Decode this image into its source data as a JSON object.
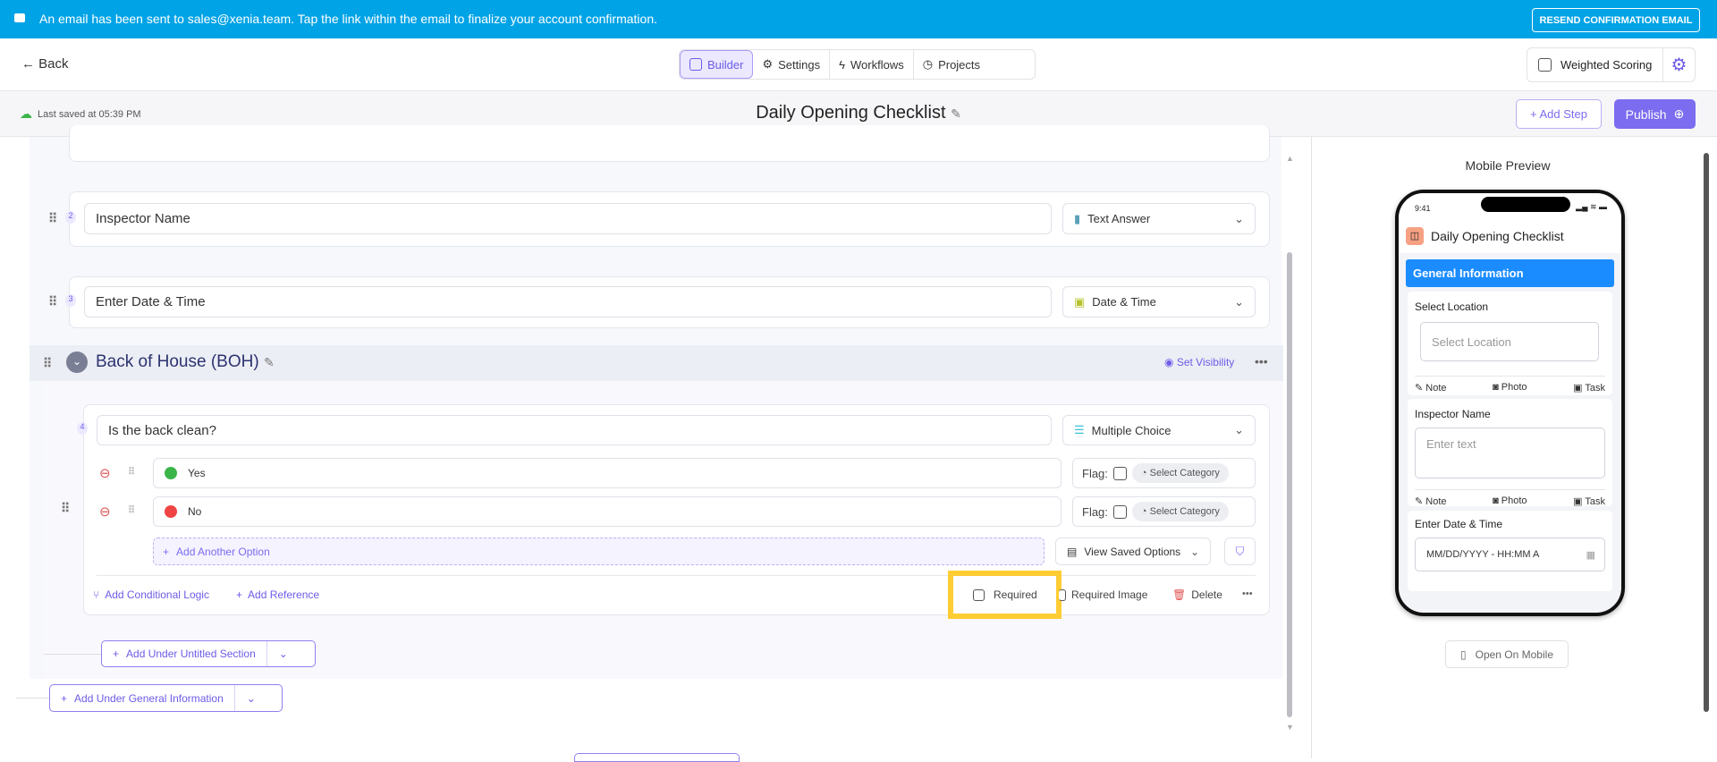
{
  "banner": {
    "message": "An email has been sent to sales@xenia.team. Tap the link within the email to finalize your account confirmation.",
    "resend_label": "RESEND CONFIRMATION EMAIL",
    "color": "#00a3e6"
  },
  "nav": {
    "back_label": "Back",
    "tabs": [
      {
        "label": "Builder",
        "active": true
      },
      {
        "label": "Settings"
      },
      {
        "label": "Workflows"
      },
      {
        "label": "Projects"
      }
    ],
    "weighted_scoring_label": "Weighted Scoring",
    "weighted_scoring_checked": false
  },
  "subheader": {
    "last_saved": "Last saved at 05:39 PM",
    "title": "Daily Opening Checklist",
    "add_step_label": "+ Add Step",
    "publish_label": "Publish"
  },
  "builder": {
    "items": [
      {
        "number": "2",
        "title": "Inspector Name",
        "type": "Text Answer"
      },
      {
        "number": "3",
        "title": "Enter Date & Time",
        "type": "Date & Time"
      }
    ],
    "section": {
      "title": "Back of House (BOH)",
      "set_visibility_label": "Set Visibility",
      "question": {
        "number": "4",
        "title": "Is the back clean?",
        "type": "Multiple Choice",
        "options": [
          {
            "label": "Yes",
            "color": "#3bb54a",
            "flag_label": "Flag:",
            "category_label": "Select Category"
          },
          {
            "label": "No",
            "color": "#ef4444",
            "flag_label": "Flag:",
            "category_label": "Select Category"
          }
        ],
        "add_option_label": "Add Another Option",
        "view_saved_label": "View Saved Options",
        "conditional_logic_label": "Add Conditional Logic",
        "reference_label": "Add Reference",
        "required_label": "Required",
        "required_image_label": "Required Image",
        "delete_label": "Delete"
      },
      "add_under_label": "Add Under Untitled Section"
    },
    "add_under_general_label": "Add Under General Information"
  },
  "preview": {
    "heading": "Mobile Preview",
    "time": "9:41",
    "title": "Daily Opening Checklist",
    "section": "General Information",
    "fields": [
      {
        "label": "Select Location",
        "placeholder": "Select Location"
      },
      {
        "label": "Inspector Name",
        "placeholder": "Enter text"
      },
      {
        "label": "Enter Date & Time",
        "placeholder": "MM/DD/YYYY - HH:MM A"
      }
    ],
    "actions": [
      "Note",
      "Photo",
      "Task"
    ],
    "open_mobile_label": "Open On Mobile"
  }
}
